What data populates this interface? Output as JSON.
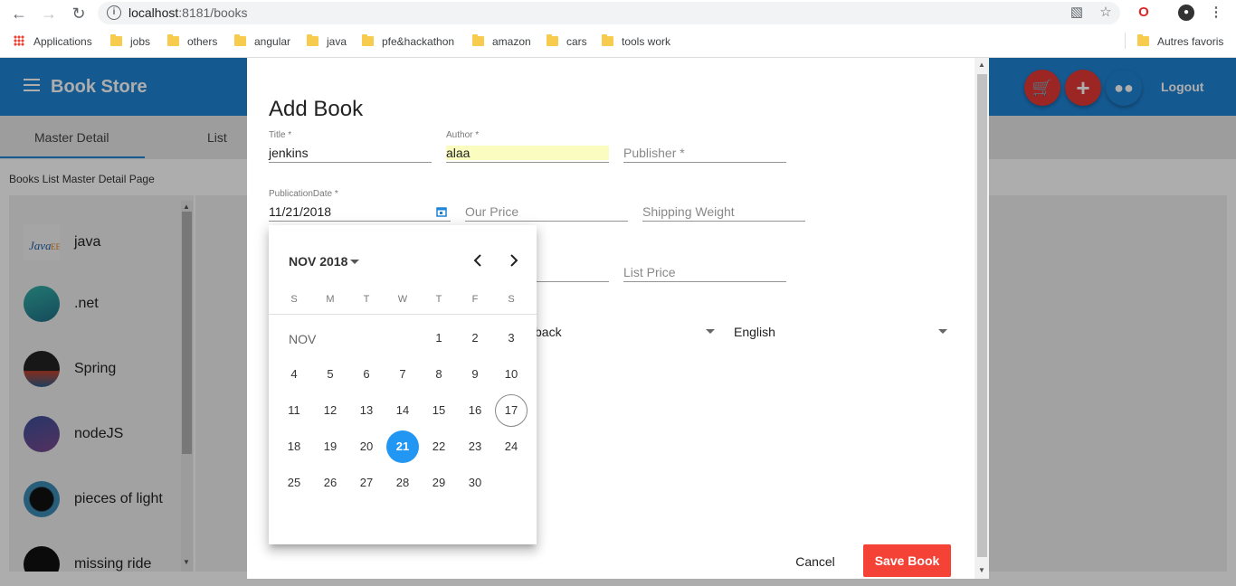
{
  "browser": {
    "url_host": "localhost",
    "url_path": ":8181/books",
    "bookmarks": [
      "Applications",
      "jobs",
      "others",
      "angular",
      "java",
      "pfe&hackathon",
      "amazon",
      "cars",
      "tools work"
    ],
    "other_bookmarks": "Autres favoris"
  },
  "app": {
    "brand": "Book Store",
    "logout": "Logout",
    "tabs": [
      "Master Detail",
      "List"
    ],
    "page_subtitle": "Books List Master Detail Page",
    "books": [
      "java",
      ".net",
      "Spring",
      "nodeJS",
      "pieces of light",
      "missing ride"
    ]
  },
  "dialog": {
    "title": "Add Book",
    "title_label": "Title *",
    "title_value": "jenkins",
    "author_label": "Author *",
    "author_value": "alaa",
    "publisher_placeholder": "Publisher *",
    "pubdate_label": "PublicationDate *",
    "pubdate_value": "11/21/2018",
    "our_price_placeholder": "Our Price",
    "shipping_weight_placeholder": "Shipping Weight",
    "list_price_placeholder": "List Price",
    "format_value_partial": "back",
    "language_value": "English",
    "cancel_label": "Cancel",
    "save_label": "Save Book"
  },
  "datepicker": {
    "period_label": "NOV 2018",
    "month_label": "NOV",
    "weekdays": [
      "S",
      "M",
      "T",
      "W",
      "T",
      "F",
      "S"
    ],
    "days": [
      "1",
      "2",
      "3",
      "4",
      "5",
      "6",
      "7",
      "8",
      "9",
      "10",
      "11",
      "12",
      "13",
      "14",
      "15",
      "16",
      "17",
      "18",
      "19",
      "20",
      "21",
      "22",
      "23",
      "24",
      "25",
      "26",
      "27",
      "28",
      "29",
      "30"
    ],
    "today": "17",
    "selected": "21",
    "prev_icon": "chevron-left-icon",
    "next_icon": "chevron-right-icon"
  },
  "colors": {
    "appbar": "#1f84d6",
    "fab_red": "#e53935",
    "save_button": "#f44336",
    "selected_day": "#2196f3",
    "author_highlight": "#fbfdc0"
  }
}
